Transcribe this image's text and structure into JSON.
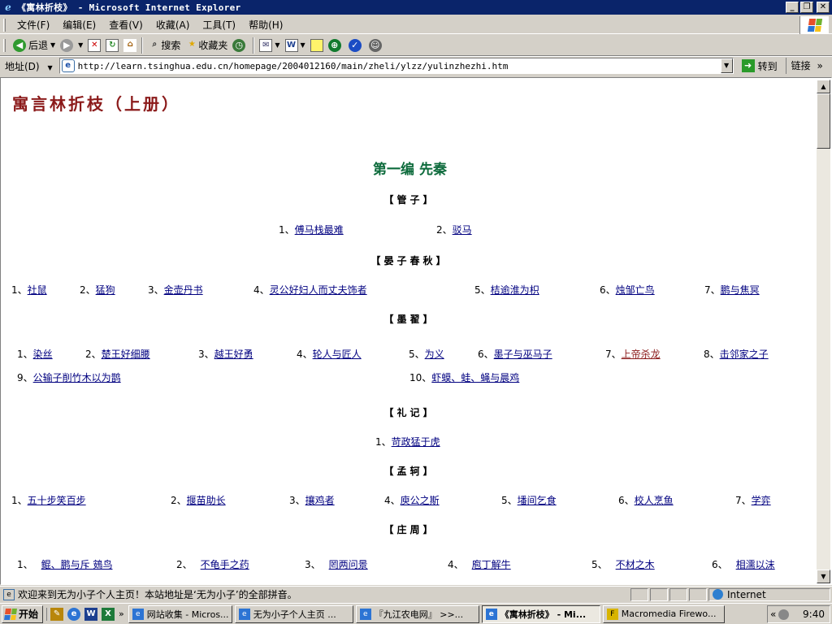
{
  "window": {
    "title": "《寓林折枝》 - Microsoft Internet Explorer",
    "controls": {
      "minimize": "_",
      "maximize": "❐",
      "close": "✕"
    }
  },
  "menu": [
    "文件(F)",
    "编辑(E)",
    "查看(V)",
    "收藏(A)",
    "工具(T)",
    "帮助(H)"
  ],
  "toolbar": {
    "back": "后退",
    "search": "搜索",
    "favorites": "收藏夹"
  },
  "address": {
    "label": "地址(D)",
    "url": "http://learn.tsinghua.edu.cn/homepage/2004012160/main/zheli/ylzz/yulinzhezhi.htm",
    "go": "转到",
    "links": "链接"
  },
  "page": {
    "book_title": "寓言林折枝（上册）",
    "part_title": "第一编  先秦",
    "sections": [
      {
        "title": "【管子】",
        "items": [
          "1、",
          "傅马栈最难",
          "2、",
          "驳马"
        ]
      },
      {
        "title": "【晏子春秋】",
        "items": [
          "1、",
          "社鼠",
          "2、",
          "猛狗",
          "3、",
          "金壶丹书",
          "4、",
          "灵公好妇人而丈夫饰者",
          "5、",
          "桔逾淮为枳",
          "6、",
          "烛邹亡鸟",
          "7、",
          "鹏与焦冥"
        ]
      },
      {
        "title": "【墨翟】",
        "items": [
          "1、",
          "染丝",
          "2、",
          "楚王好细腰",
          "3、",
          "越王好勇",
          "4、",
          "轮人与匠人",
          "5、",
          "为义",
          "6、",
          "墨子与巫马子",
          "7、",
          "上帝杀龙",
          "8、",
          "击邻家之子",
          "9、",
          "公输子削竹木以为鹊",
          "10、",
          "虾蟆、蛙、蝇与晨鸡"
        ]
      },
      {
        "title": "【礼记】",
        "items": [
          "1、",
          "苛政猛于虎"
        ]
      },
      {
        "title": "【孟轲】",
        "items": [
          "1、",
          "五十步笑百步",
          "2、",
          "揠苗助长",
          "3、",
          "攘鸡者",
          "4、",
          "庾公之斯",
          "5、",
          "墦间乞食",
          "6、",
          "校人烹鱼",
          "7、",
          "学弈"
        ]
      },
      {
        "title": "【庄周】",
        "items": [
          "1、",
          "鲲、鹏与斥 鴳鸟",
          "2、",
          "不龟手之药",
          "3、",
          "罔两问景",
          "4、",
          "庖丁解牛",
          "5、",
          "不材之木",
          "6、",
          "相濡以沫"
        ]
      }
    ]
  },
  "status": {
    "text": "欢迎来到无为小子个人主页！本站地址是‘无为小子’的全部拼音。",
    "zone": "Internet"
  },
  "taskbar": {
    "start": "开始",
    "tasks": [
      "网站收集 - Micros...",
      "无为小子个人主页 ...",
      "『九江农电网』 >>...",
      "《寓林折枝》 - Mi...",
      "Macromedia Firewo..."
    ],
    "tray_chevron": "«",
    "clock": "9:40"
  }
}
